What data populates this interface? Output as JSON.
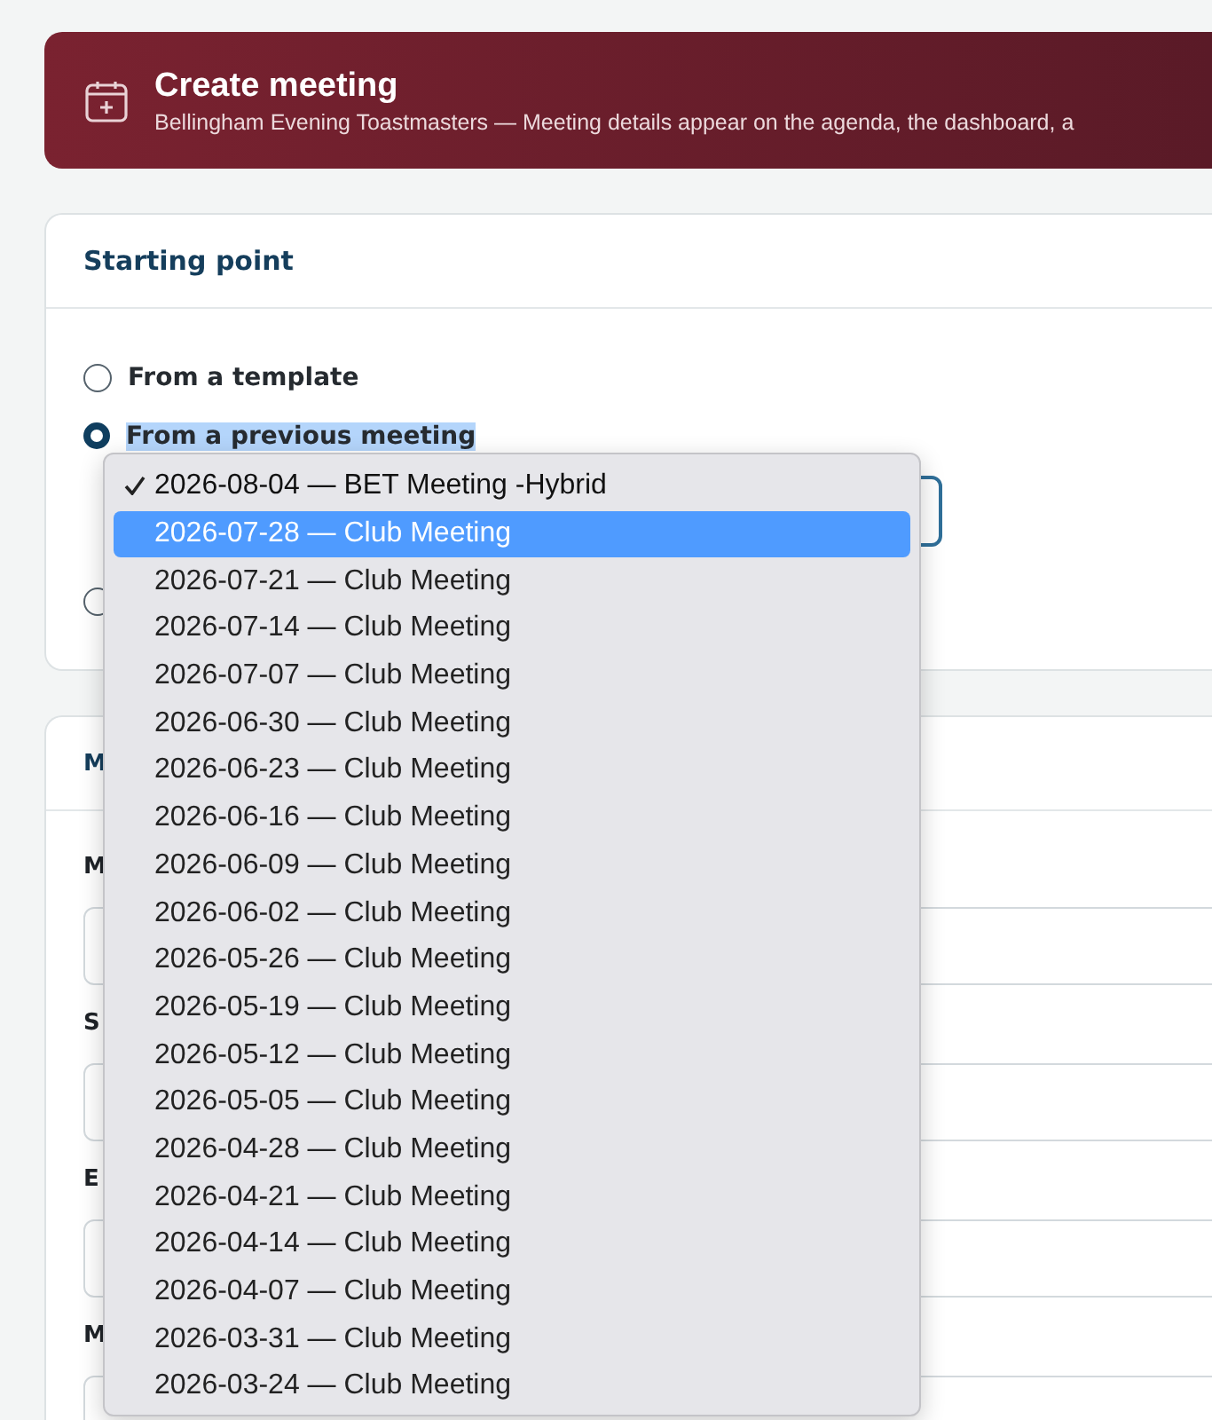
{
  "header": {
    "title": "Create meeting",
    "subtitle": "Bellingham Evening Toastmasters — Meeting details appear on the agenda, the dashboard, a"
  },
  "starting_point": {
    "title": "Starting point",
    "options": [
      {
        "label": "From a template",
        "selected": false
      },
      {
        "label": "From a previous meeting",
        "selected": true
      },
      {
        "selected": false
      }
    ]
  },
  "dropdown": {
    "options": [
      {
        "label": "2026-08-04 — BET Meeting -Hybrid",
        "selected": true,
        "highlighted": false
      },
      {
        "label": "2026-07-28 — Club Meeting",
        "selected": false,
        "highlighted": true
      },
      {
        "label": "2026-07-21 — Club Meeting",
        "selected": false,
        "highlighted": false
      },
      {
        "label": "2026-07-14 — Club Meeting",
        "selected": false,
        "highlighted": false
      },
      {
        "label": "2026-07-07 — Club Meeting",
        "selected": false,
        "highlighted": false
      },
      {
        "label": "2026-06-30 — Club Meeting",
        "selected": false,
        "highlighted": false
      },
      {
        "label": "2026-06-23 — Club Meeting",
        "selected": false,
        "highlighted": false
      },
      {
        "label": "2026-06-16 — Club Meeting",
        "selected": false,
        "highlighted": false
      },
      {
        "label": "2026-06-09 — Club Meeting",
        "selected": false,
        "highlighted": false
      },
      {
        "label": "2026-06-02 — Club Meeting",
        "selected": false,
        "highlighted": false
      },
      {
        "label": "2026-05-26 — Club Meeting",
        "selected": false,
        "highlighted": false
      },
      {
        "label": "2026-05-19 — Club Meeting",
        "selected": false,
        "highlighted": false
      },
      {
        "label": "2026-05-12 — Club Meeting",
        "selected": false,
        "highlighted": false
      },
      {
        "label": "2026-05-05 — Club Meeting",
        "selected": false,
        "highlighted": false
      },
      {
        "label": "2026-04-28 — Club Meeting",
        "selected": false,
        "highlighted": false
      },
      {
        "label": "2026-04-21 — Club Meeting",
        "selected": false,
        "highlighted": false
      },
      {
        "label": "2026-04-14 — Club Meeting",
        "selected": false,
        "highlighted": false
      },
      {
        "label": "2026-04-07 — Club Meeting",
        "selected": false,
        "highlighted": false
      },
      {
        "label": "2026-03-31 — Club Meeting",
        "selected": false,
        "highlighted": false
      },
      {
        "label": "2026-03-24 — Club Meeting",
        "selected": false,
        "highlighted": false
      }
    ]
  },
  "details": {
    "title": "M",
    "fields": [
      {
        "label": "M"
      },
      {
        "label": "S"
      },
      {
        "label": "E"
      },
      {
        "label": "M"
      }
    ]
  }
}
